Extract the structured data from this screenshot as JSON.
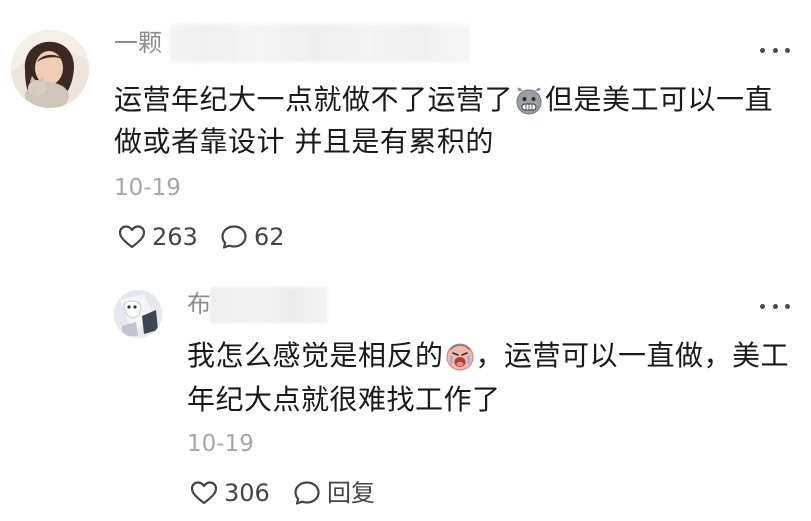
{
  "main_comment": {
    "username_visible": "一颗",
    "text_line1_a": "运营年纪大一点就做不了运营了",
    "text_line1_b": "但是美工可以一直",
    "text_line2": "做或者靠设计 并且是有累积的",
    "emoji": "grimace-emoji",
    "date": "10-19",
    "likes": "263",
    "comments": "62"
  },
  "reply_comment": {
    "username_visible": "布",
    "text_line1_a": "我怎么感觉是相反的",
    "text_line1_b": "，运营可以一直做，美工",
    "text_line2": "年纪大点就很难找工作了",
    "emoji": "crying-emoji",
    "date": "10-19",
    "likes": "306",
    "reply_label": "回复"
  },
  "colors": {
    "text_primary": "#1a1a1a",
    "text_secondary": "#8c8c8c",
    "timestamp": "#a6a6a6",
    "icon": "#444444"
  }
}
